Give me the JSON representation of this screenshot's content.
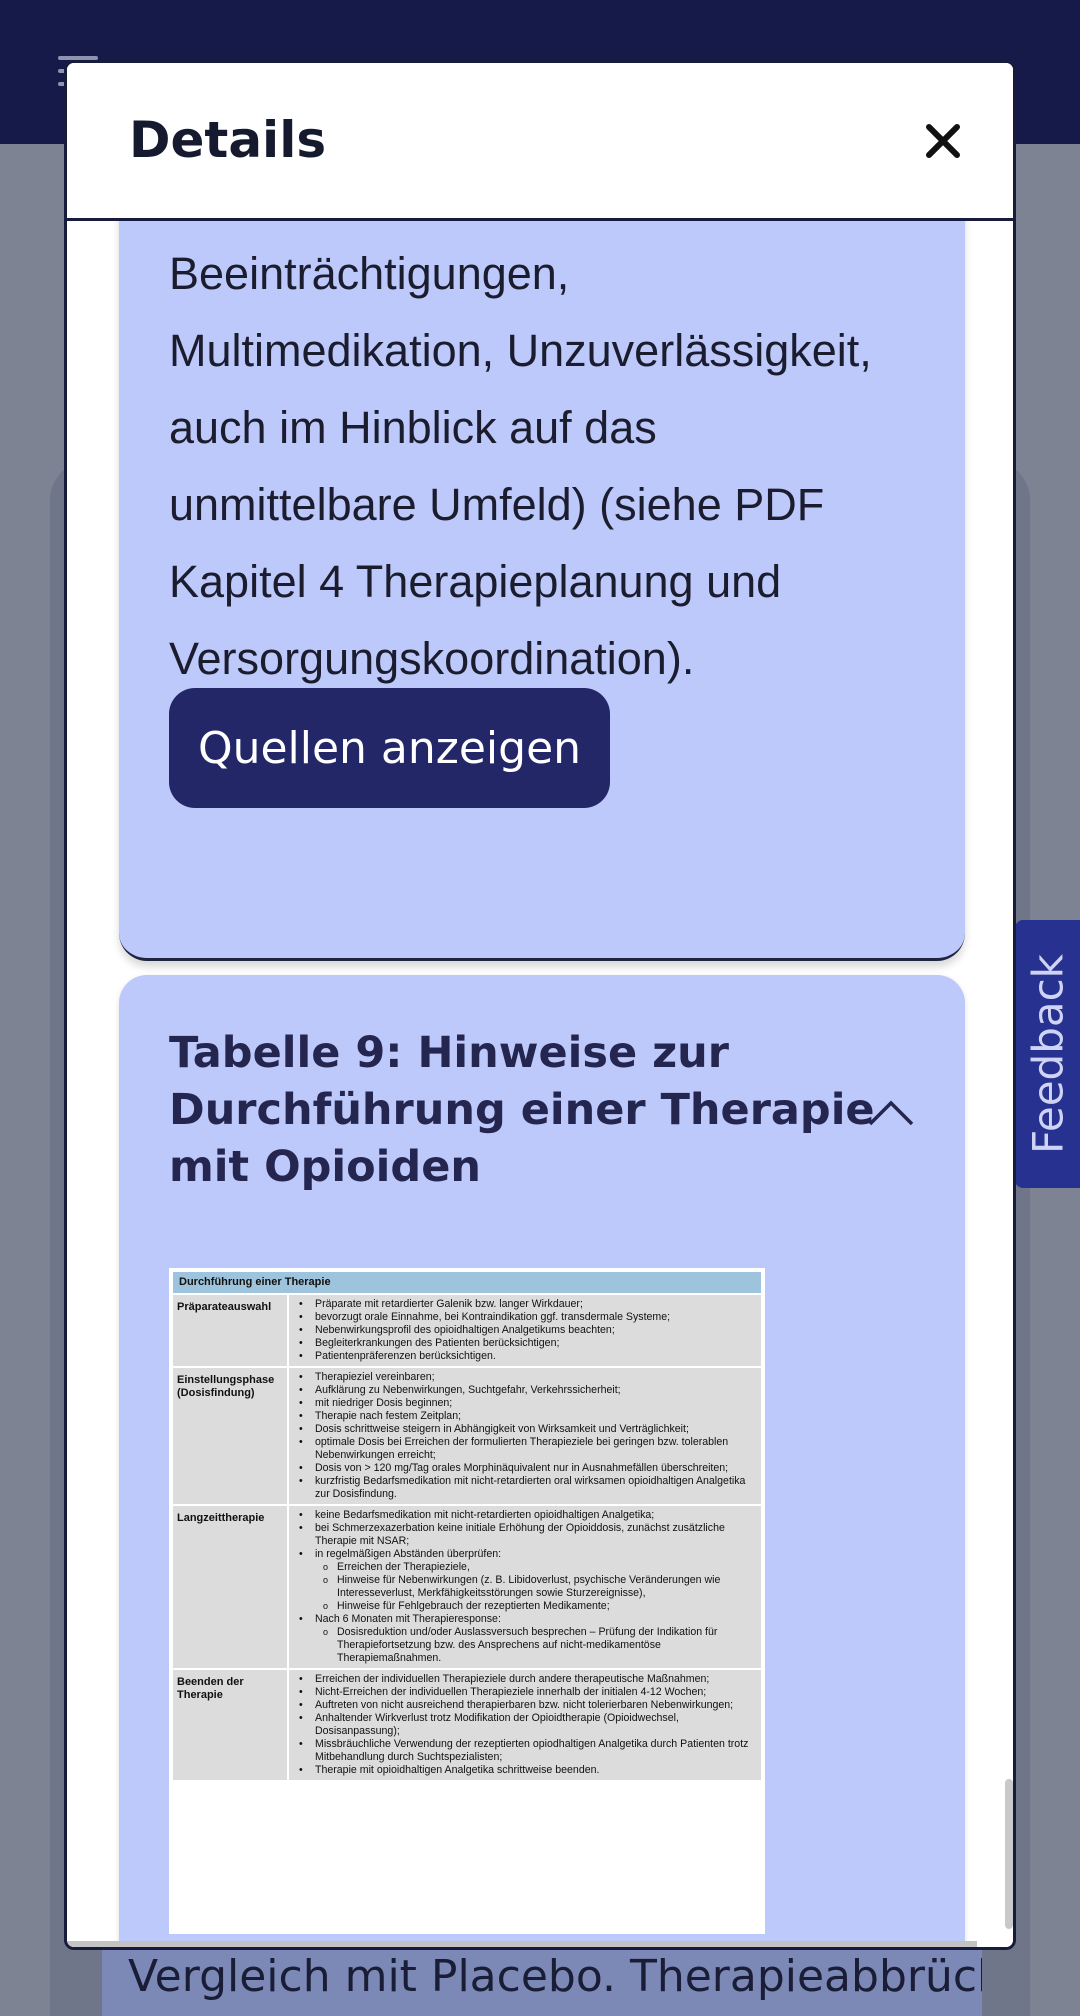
{
  "background": {
    "bottom_text": "Vergleich mit Placebo. Therapieabbrüche"
  },
  "feedback": {
    "label": "Feedback"
  },
  "modal": {
    "title": "Details",
    "close_icon": "close-icon",
    "card1": {
      "lines": [
        "Beeinträchtigungen,",
        "Multimedikation, Unzuverlässigkeit,",
        "auch im Hinblick auf das",
        "unmittelbare Umfeld) (siehe PDF",
        "Kapitel 4 Therapieplanung und",
        "Versorgungskoordination)."
      ],
      "button_label": "Quellen anzeigen"
    },
    "card2": {
      "title_lines": [
        "Tabelle 9: Hinweise zur",
        "Durchführung einer Therapie",
        "mit Opioiden"
      ],
      "toggle_icon": "chevron-up-icon",
      "table": {
        "header": "Durchführung einer Therapie",
        "rows": [
          {
            "category": "Präparateauswahl",
            "items": [
              "Präparate mit retardierter Galenik bzw. langer Wirkdauer;",
              "bevorzugt orale Einnahme, bei Kontraindikation ggf. transdermale Systeme;",
              "Nebenwirkungsprofil des opioidhaltigen Analgetikums beachten;",
              "Begleiterkrankungen des Patienten berücksichtigen;",
              "Patientenpräferenzen berücksichtigen."
            ]
          },
          {
            "category": "Einstellungsphase\n(Dosisfindung)",
            "items": [
              "Therapieziel vereinbaren;",
              "Aufklärung zu Nebenwirkungen, Suchtgefahr, Verkehrssicherheit;",
              "mit niedriger Dosis beginnen;",
              "Therapie nach festem Zeitplan;",
              "Dosis schrittweise steigern in Abhängigkeit von Wirksamkeit und Verträglichkeit;",
              "optimale Dosis bei Erreichen der formulierten Therapieziele bei geringen bzw. tolerablen Nebenwirkungen erreicht;",
              "Dosis von > 120 mg/Tag orales Morphinäquivalent nur in Ausnahmefällen überschreiten;",
              "kurzfristig Bedarfsmedikation mit nicht-retardierten oral wirksamen opioidhaltigen Analgetika zur Dosisfindung."
            ]
          },
          {
            "category": "Langzeittherapie",
            "items": [
              "keine Bedarfsmedikation mit nicht-retardierten opioidhaltigen Analgetika;",
              "bei Schmerzexazerbation keine initiale Erhöhung der Opioiddosis, zunächst zusätzliche Therapie mit NSAR;",
              "in regelmäßigen Abständen überprüfen:",
              "Erreichen der Therapieziele,",
              "Hinweise für Nebenwirkungen (z. B. Libidoverlust, psychische Veränderungen wie Interesseverlust, Merkfähigkeitsstörungen sowie Sturzereignisse),",
              "Hinweise für Fehlgebrauch der rezeptierten Medikamente;",
              "Nach 6 Monaten mit Therapieresponse:",
              "Dosisreduktion und/oder Auslassversuch besprechen – Prüfung der Indikation für Therapiefortsetzung bzw. des Ansprechens auf nicht-medikamentöse Therapiemaßnahmen."
            ]
          },
          {
            "category": "Beenden der\nTherapie",
            "items": [
              "Erreichen der individuellen Therapieziele durch andere therapeutische Maßnahmen;",
              "Nicht-Erreichen der individuellen Therapieziele innerhalb der initialen 4-12 Wochen;",
              "Auftreten von nicht ausreichend therapierbaren bzw. nicht tolerierbaren Nebenwirkungen;",
              "Anhaltender Wirkverlust trotz Modifikation der Opioidtherapie (Opioidwechsel, Dosisanpassung);",
              "Missbräuchliche Verwendung der rezeptierten opiodhaltigen Analgetika durch Patienten trotz Mitbehandlung durch Suchtspezialisten;",
              "Therapie mit opioidhaltigen Analgetika schrittweise beenden."
            ]
          }
        ]
      }
    }
  }
}
